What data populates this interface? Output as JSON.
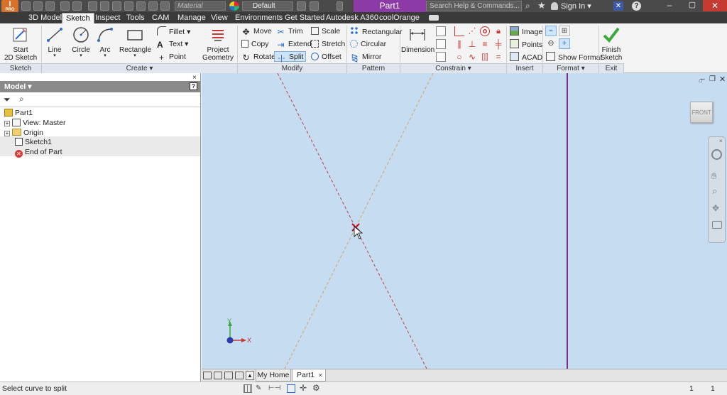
{
  "title_bar": {
    "app_badge": "I",
    "app_sub": "PRO",
    "material": "Material",
    "appearance": "Default",
    "doc_title": "Part1",
    "search_placeholder": "Search Help & Commands...",
    "sign_in": "Sign In"
  },
  "tabs": [
    "3D Model",
    "Sketch",
    "Inspect",
    "Tools",
    "CAM",
    "Manage",
    "View",
    "Environments",
    "Get Started",
    "Autodesk A360",
    "coolOrange"
  ],
  "active_tab": "Sketch",
  "ribbon": {
    "start_sketch": "Start\n2D Sketch",
    "line": "Line",
    "circle": "Circle",
    "arc": "Arc",
    "rectangle": "Rectangle",
    "fillet": "Fillet",
    "text": "Text",
    "point": "Point",
    "project_geometry": "Project\nGeometry",
    "move": "Move",
    "copy": "Copy",
    "rotate": "Rotate",
    "trim": "Trim",
    "extend": "Extend",
    "split": "Split",
    "scale": "Scale",
    "stretch": "Stretch",
    "offset": "Offset",
    "pattern_rectangular": "Rectangular",
    "pattern_circular": "Circular",
    "pattern_mirror": "Mirror",
    "dimension": "Dimension",
    "image": "Image",
    "points": "Points",
    "acad": "ACAD",
    "show_format": "Show Format",
    "finish_sketch": "Finish\nSketch"
  },
  "panels": {
    "sketch": "Sketch",
    "create": "Create ▾",
    "modify": "Modify",
    "pattern": "Pattern",
    "constrain": "Constrain ▾",
    "insert": "Insert",
    "format": "Format ▾",
    "exit": "Exit"
  },
  "browser": {
    "header": "Model ▾",
    "help": "?",
    "close": "×",
    "items": [
      {
        "label": "Part1"
      },
      {
        "label": "View: Master"
      },
      {
        "label": "Origin"
      },
      {
        "label": "Sketch1"
      },
      {
        "label": "End of Part"
      }
    ]
  },
  "viewcube": {
    "face": "FRONT"
  },
  "axis": {
    "x": "X",
    "y": "Y"
  },
  "doc_tabs": {
    "home": "My Home",
    "part": "Part1"
  },
  "status": {
    "prompt": "Select curve to split",
    "num1": "1",
    "num2": "1"
  },
  "colors": {
    "ribbon_active": "#cfe4f7",
    "canvas": "#c5dcf1",
    "purple": "#7a2b8c",
    "line_red": "#c0404a",
    "line_orange": "#d9a060"
  }
}
